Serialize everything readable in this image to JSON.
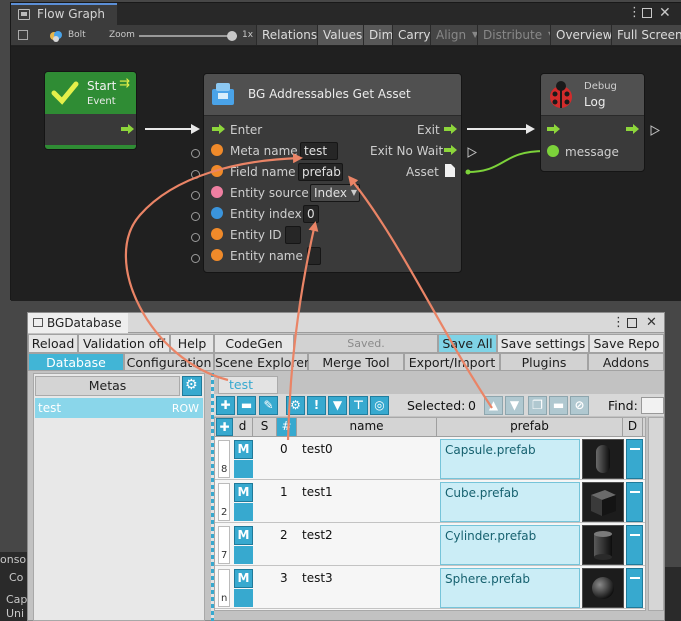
{
  "flow_graph": {
    "tab_title": "Flow Graph",
    "toolbar": {
      "bolt_label": "Bolt",
      "zoom_label": "Zoom",
      "zoom_value": "1x",
      "zoom_level": 1.0,
      "buttons": [
        "Relations",
        "Values",
        "Dim",
        "Carry",
        "Align",
        "Distribute",
        "Overview",
        "Full Screen"
      ]
    },
    "nodes": {
      "start": {
        "title": "Start",
        "subtitle": "Event"
      },
      "get_asset": {
        "title": "BG Addressables Get Asset",
        "inputs": [
          {
            "label": "Enter"
          },
          {
            "label": "Meta  name",
            "value": "test"
          },
          {
            "label": "Field  name",
            "value": "prefab"
          },
          {
            "label": "Entity  source",
            "value": "Index"
          },
          {
            "label": "Entity  index",
            "value": "0"
          },
          {
            "label": "Entity  ID",
            "value": ""
          },
          {
            "label": "Entity  name",
            "value": ""
          }
        ],
        "outputs": [
          "Exit",
          "Exit No Wait",
          "Asset"
        ]
      },
      "debug_log": {
        "subtitle": "Debug",
        "title": "Log",
        "input_label": "message"
      }
    },
    "colors": {
      "start_header": "#2f8c34",
      "flow_arrow": "#8dd63b",
      "port_orange": "#f08a2a",
      "port_pink": "#ef7fa1",
      "port_blue": "#3a94dc",
      "port_green": "#7cd23a",
      "annotation_arrow": "#ea8466"
    }
  },
  "bg_database": {
    "tab_title": "BGDatabase",
    "actions": [
      "Reload",
      "Validation off",
      "Help",
      "CodeGen",
      "Saved.",
      "Save All",
      "Save settings",
      "Save Repo"
    ],
    "tabs": [
      "Database",
      "Configuration",
      "Scene Explorer",
      "Merge Tool",
      "Export/Import",
      "Plugins",
      "Addons"
    ],
    "active_tab": "Database",
    "metas_header": "Metas",
    "metas": [
      {
        "name": "test",
        "type": "ROW"
      }
    ],
    "table_tab": "test",
    "selected_label": "Selected:",
    "selected_count": "0",
    "find_label": "Find:",
    "columns": [
      "d",
      "S",
      "#",
      "name",
      "prefab",
      "D"
    ],
    "rows": [
      {
        "id_hint": "8",
        "index": "0",
        "name": "test0",
        "prefab": "Capsule.prefab",
        "shape": "capsule-thumbnail"
      },
      {
        "id_hint": "2",
        "index": "1",
        "name": "test1",
        "prefab": "Cube.prefab",
        "shape": "cube-thumbnail"
      },
      {
        "id_hint": "7",
        "index": "2",
        "name": "test2",
        "prefab": "Cylinder.prefab",
        "shape": "cylinder-thumbnail"
      },
      {
        "id_hint": "n",
        "index": "3",
        "name": "test3",
        "prefab": "Sphere.prefab",
        "shape": "sphere-thumbnail"
      }
    ],
    "m_label": "M",
    "colors": {
      "accent": "#37a9cf",
      "active_tab": "#41b5d6",
      "prefab_cell": "#cbedf6"
    }
  },
  "background_fragments": {
    "left_text_1": "onso",
    "left_text_2": "Co",
    "left_text_3": "Cap",
    "left_text_4": "Uni"
  }
}
